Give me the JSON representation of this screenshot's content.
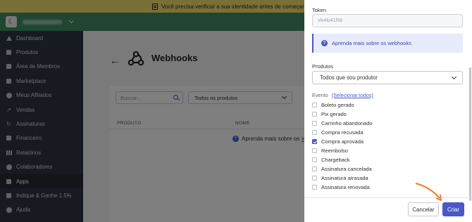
{
  "banner": {
    "text": "Você precisa verificar a sua identidade antes de começar a"
  },
  "sidebar": {
    "items": [
      {
        "label": "Dashboard"
      },
      {
        "label": "Produtos"
      },
      {
        "label": "Área de Membros"
      },
      {
        "label": "Marketplace"
      },
      {
        "label": "Meus Afiliados"
      },
      {
        "label": "Vendas"
      },
      {
        "label": "Assinaturas"
      },
      {
        "label": "Financeiro"
      },
      {
        "label": "Relatórios"
      },
      {
        "label": "Colaboradores"
      },
      {
        "label": "Apps"
      },
      {
        "label": "Indique & Ganhe 1.5%"
      },
      {
        "label": "Ajuda"
      }
    ]
  },
  "page": {
    "title": "Webhooks",
    "search_placeholder": "Buscar...",
    "product_filter": "Todos os produtos",
    "columns": {
      "produto": "PRODUTO",
      "nome": "NOME"
    },
    "learn_text": "Aprenda mais sobre os",
    "learn_link": "we"
  },
  "panel": {
    "token_label": "Token",
    "token_value": "vlv4lo41l58",
    "info_text": "Aprenda mais sobre os webhooks",
    "produtos_label": "Produtos",
    "produtos_value": "Todos que sou produtor",
    "evento_label": "Evento",
    "select_all": "(Selecionar todos)",
    "events": [
      {
        "label": "Boleto gerado",
        "checked": false
      },
      {
        "label": "Pix gerado",
        "checked": false
      },
      {
        "label": "Carrinho abandonado",
        "checked": false
      },
      {
        "label": "Compra recusada",
        "checked": false
      },
      {
        "label": "Compra aprovada",
        "checked": true
      },
      {
        "label": "Reembolso",
        "checked": false
      },
      {
        "label": "Chargeback",
        "checked": false
      },
      {
        "label": "Assinatura cancelada",
        "checked": false
      },
      {
        "label": "Assinatura atrasada",
        "checked": false
      },
      {
        "label": "Assinatura renovada",
        "checked": false
      }
    ],
    "cancel_label": "Cancelar",
    "create_label": "Criar"
  },
  "colors": {
    "accent": "#4a57c7",
    "brand_green": "#3c8c61",
    "sidebar_bg": "#2f3540",
    "banner_bg": "#f5e06e",
    "arrow": "#f07a2a"
  }
}
